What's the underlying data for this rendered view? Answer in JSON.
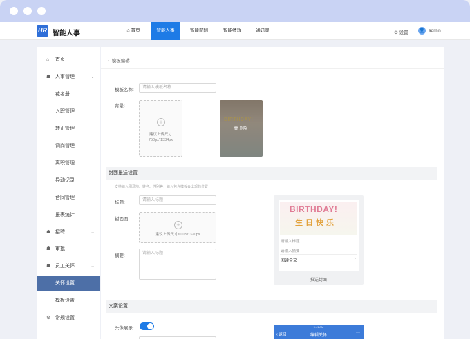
{
  "app": {
    "logo": "HR",
    "name": "智能人事"
  },
  "nav": {
    "tabs": [
      {
        "label": "首页",
        "icon": "home-icon"
      },
      {
        "label": "智能人事"
      },
      {
        "label": "智能薪酬"
      },
      {
        "label": "智能绩效"
      },
      {
        "label": "通讯录"
      }
    ],
    "settings": "设置",
    "user": "admin",
    "accent": "#1e7be6"
  },
  "sidebar": {
    "items": [
      {
        "label": "首页",
        "icon": "home-icon"
      },
      {
        "label": "人事管理",
        "icon": "users-icon",
        "expandable": true
      },
      {
        "label": "花名册"
      },
      {
        "label": "入职管理"
      },
      {
        "label": "转正管理"
      },
      {
        "label": "调岗管理"
      },
      {
        "label": "离职管理"
      },
      {
        "label": "异动记录"
      },
      {
        "label": "合同管理"
      },
      {
        "label": "报表统计"
      },
      {
        "label": "招聘",
        "icon": "recruit-icon",
        "expandable": true
      },
      {
        "label": "审批",
        "icon": "approve-icon"
      },
      {
        "label": "员工关怀",
        "icon": "care-icon",
        "expandable": true
      },
      {
        "label": "关怀设置",
        "active": true
      },
      {
        "label": "模板设置"
      },
      {
        "label": "常规设置",
        "icon": "gear-icon"
      }
    ]
  },
  "main": {
    "breadcrumb": "模板编辑",
    "template_name_label": "模板名称:",
    "template_name_placeholder": "请输入模板名称",
    "background_label": "背景:",
    "upload_line1": "建议上传尺寸",
    "upload_line2": "750px*1334px",
    "thumb_title": "BIRTHDAY!",
    "thumb_delete": "删除",
    "push_section": "封面推送设置",
    "push_hint": "支持输入图源地、姓名、性别等，输入包含模板会出现的位置",
    "title_label": "标题:",
    "title_placeholder": "请输入标题",
    "cover_label": "封面图:",
    "cover_hint": "建议上传尺寸600px*320px",
    "summary_label": "摘要:",
    "summary_placeholder": "请输入标题",
    "preview": {
      "img_title": "BIRTHDAY!",
      "img_sub": "生日快乐",
      "title": "请输入标题",
      "summary": "请输入摘要",
      "read_more": "阅读全文",
      "caption": "推送封面"
    },
    "copy_section": "文案设置",
    "avatar_label": "头像展示:",
    "avatar_on": true,
    "phone": {
      "status": "9:41 AM",
      "back": "返回",
      "title": "编辑关怀",
      "more": "···"
    }
  }
}
